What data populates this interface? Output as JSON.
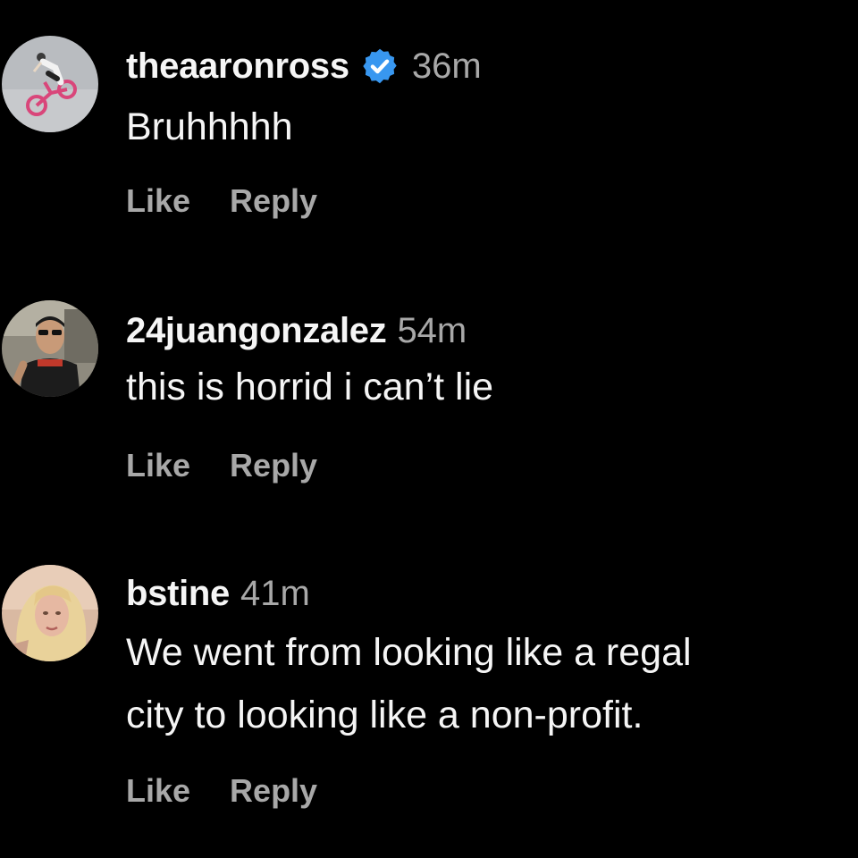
{
  "comments": [
    {
      "username": "theaaronross",
      "verified": true,
      "time": "36m",
      "text": "Bruhhhhh",
      "avatar_icon": "bmx-rider-avatar",
      "like_label": "Like",
      "reply_label": "Reply"
    },
    {
      "username": "24juangonzalez",
      "verified": false,
      "time": "54m",
      "text": "this is horrid i can’t lie",
      "avatar_icon": "person-sunglasses-avatar",
      "like_label": "Like",
      "reply_label": "Reply"
    },
    {
      "username": "bstine",
      "verified": false,
      "time": "41m",
      "text": "We went from looking like a regal\ncity to looking like a non-profit.",
      "avatar_icon": "blonde-woman-avatar",
      "like_label": "Like",
      "reply_label": "Reply"
    }
  ],
  "colors": {
    "background": "#000000",
    "primary_text": "#f5f5f5",
    "secondary_text": "#a8a8a8",
    "verified_badge": "#3897f0"
  }
}
